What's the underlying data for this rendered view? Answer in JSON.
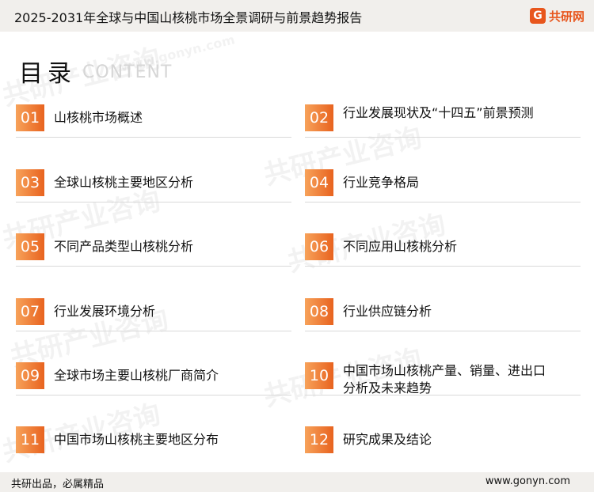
{
  "header": {
    "title": "2025-2031年全球与中国山核桃市场全景调研与前景趋势报告",
    "logo_text": "共研网",
    "logo_mark": "G"
  },
  "heading": {
    "cn": "目录",
    "en": "CONTENT"
  },
  "watermark": {
    "text": "共研产业咨询",
    "domain": "www.gonyn.com"
  },
  "toc": [
    {
      "num": "01",
      "label": "山核桃市场概述"
    },
    {
      "num": "02",
      "label": "行业发展现状及“十四五”前景预测"
    },
    {
      "num": "03",
      "label": "全球山核桃主要地区分析"
    },
    {
      "num": "04",
      "label": "行业竞争格局"
    },
    {
      "num": "05",
      "label": "不同产品类型山核桃分析"
    },
    {
      "num": "06",
      "label": "不同应用山核桃分析"
    },
    {
      "num": "07",
      "label": "行业发展环境分析"
    },
    {
      "num": "08",
      "label": "行业供应链分析"
    },
    {
      "num": "09",
      "label": "全球市场主要山核桃厂商简介"
    },
    {
      "num": "10",
      "label": "中国市场山核桃产量、销量、进出口分析及未来趋势"
    },
    {
      "num": "11",
      "label": "中国市场山核桃主要地区分布"
    },
    {
      "num": "12",
      "label": "研究成果及结论"
    }
  ],
  "footer": {
    "left": "共研出品，必属精品",
    "right": "www.gonyn.com"
  },
  "colors": {
    "accent": "#e8631f",
    "accent_light": "#f7a25a",
    "bar_bg": "#f1efec"
  }
}
